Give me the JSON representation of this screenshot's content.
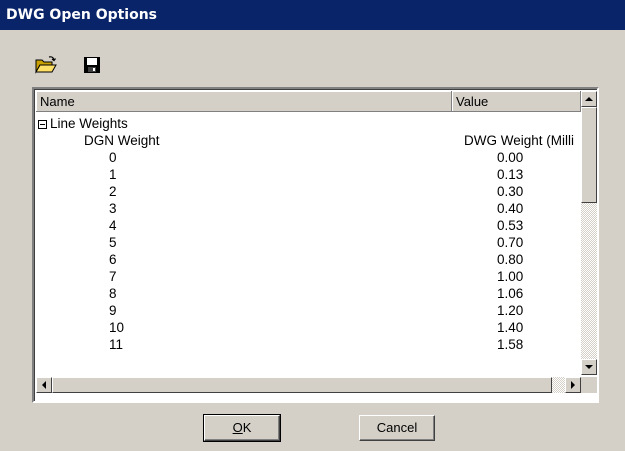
{
  "window": {
    "title": "DWG Open Options"
  },
  "toolbar": {
    "open_icon": "folder-open-icon",
    "save_icon": "floppy-disk-icon"
  },
  "list": {
    "columns": [
      "Name",
      "Value"
    ],
    "group_label": "Line Weights",
    "subheader": {
      "name": "DGN Weight",
      "value": "DWG Weight (Milli"
    },
    "rows": [
      {
        "name": "0",
        "value": "0.00"
      },
      {
        "name": "1",
        "value": "0.13"
      },
      {
        "name": "2",
        "value": "0.30"
      },
      {
        "name": "3",
        "value": "0.40"
      },
      {
        "name": "4",
        "value": "0.53"
      },
      {
        "name": "5",
        "value": "0.70"
      },
      {
        "name": "6",
        "value": "0.80"
      },
      {
        "name": "7",
        "value": "1.00"
      },
      {
        "name": "8",
        "value": "1.06"
      },
      {
        "name": "9",
        "value": "1.20"
      },
      {
        "name": "10",
        "value": "1.40"
      },
      {
        "name": "11",
        "value": "1.58"
      }
    ]
  },
  "buttons": {
    "ok_mnemonic": "O",
    "ok_rest": "K",
    "cancel": "Cancel"
  },
  "colors": {
    "titlebar": "#0a246a",
    "face": "#d4d0c8"
  }
}
